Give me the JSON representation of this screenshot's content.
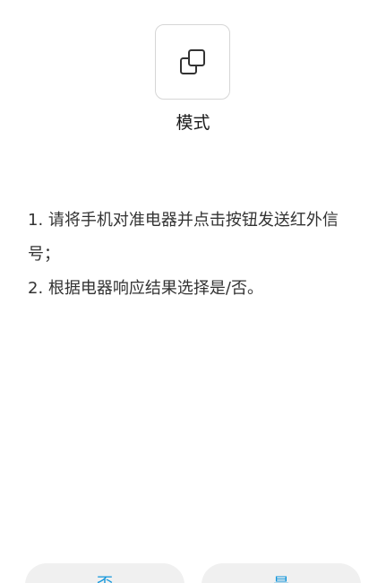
{
  "mode": {
    "icon": "copy-icon",
    "label": "模式"
  },
  "instructions": {
    "step1": "1. 请将手机对准电器并点击按钮发送红外信号；",
    "step2": "2. 根据电器响应结果选择是/否。"
  },
  "answers": {
    "no_label": "否",
    "yes_label": "是"
  },
  "colors": {
    "accent": "#1296db",
    "button_bg": "#f0f0f0",
    "border": "#d6d6d6"
  }
}
